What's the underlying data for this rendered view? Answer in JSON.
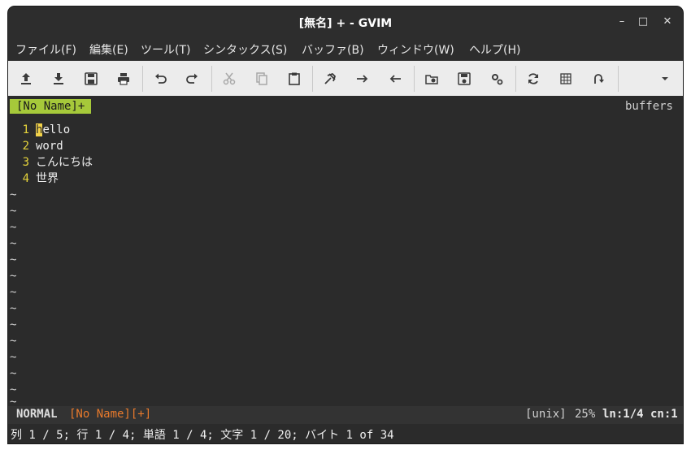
{
  "window": {
    "title": "[無名] + - GVIM"
  },
  "window_controls": {
    "minimize": "–",
    "maximize": "□",
    "close": "✕"
  },
  "menubar": [
    "ファイル(F)",
    "編集(E)",
    "ツール(T)",
    "シンタックス(S)",
    "バッファ(B)",
    "ウィンドウ(W)",
    "ヘルプ(H)"
  ],
  "toolbar": {
    "icons": [
      "open-file-icon",
      "save-file-icon",
      "save-all-icon",
      "print-icon",
      "undo-icon",
      "redo-icon",
      "cut-icon",
      "copy-icon",
      "paste-icon",
      "find-replace-icon",
      "find-next-icon",
      "find-previous-icon",
      "load-session-icon",
      "save-session-icon",
      "run-script-icon",
      "make-icon",
      "run-ctags-icon",
      "jump-tag-icon",
      "overflow-menu-icon"
    ]
  },
  "tabline": {
    "active_tab": "[No Name]+",
    "right_label": "buffers"
  },
  "buffer": {
    "lines": [
      {
        "num": "1",
        "cursor_char": "h",
        "rest": "ello"
      },
      {
        "num": "2",
        "text": "word"
      },
      {
        "num": "3",
        "text": "こんにちは"
      },
      {
        "num": "4",
        "text": "世界"
      }
    ],
    "empty_marker": "~"
  },
  "statusline": {
    "mode": "NORMAL",
    "filename": "[No Name][+]",
    "fileformat": "[unix]",
    "percent": "25%",
    "position": "ln:1/4 cn:1"
  },
  "cmdline": {
    "text": "列 1 / 5; 行 1 / 4; 単語 1 / 4; 文字 1 / 20; バイト 1 of 34"
  },
  "colors": {
    "accent": "#a6c93a",
    "line_number": "#e6d43b",
    "filename": "#e87a2c",
    "cursor": "#f2d24a"
  }
}
